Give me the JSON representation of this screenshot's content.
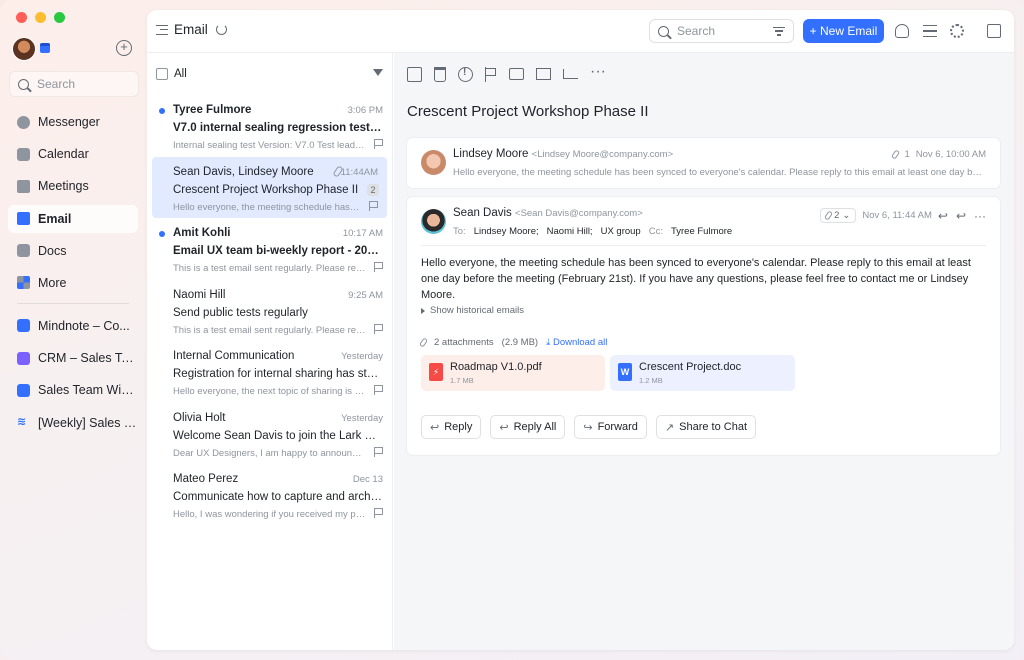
{
  "nav": {
    "search_placeholder": "Search",
    "items": [
      {
        "label": "Messenger",
        "icon": "messenger-icon"
      },
      {
        "label": "Calendar",
        "icon": "calendar-icon"
      },
      {
        "label": "Meetings",
        "icon": "meetings-icon"
      },
      {
        "label": "Email",
        "icon": "email-icon"
      },
      {
        "label": "Docs",
        "icon": "docs-icon"
      },
      {
        "label": "More",
        "icon": "more-icon"
      }
    ],
    "pinned": [
      {
        "label": "Mindnote – Co...",
        "icon": "mindnote-icon"
      },
      {
        "label": "CRM – Sales Te...",
        "icon": "crm-icon"
      },
      {
        "label": "Sales Team Wiki...",
        "icon": "wiki-icon"
      },
      {
        "label": "[Weekly] Sales T...",
        "icon": "weekly-icon"
      }
    ]
  },
  "topbar": {
    "title": "Email",
    "search_placeholder": "Search",
    "new_email": "+ New Email"
  },
  "list": {
    "select_all": "All",
    "mails": [
      {
        "from": "Tyree Fulmore",
        "time": "3:06 PM",
        "subject": "V7.0 internal sealing regression test rep...",
        "preview": "Internal sealing test Version: V7.0 Test leader...",
        "unread": true
      },
      {
        "from": "Sean Davis, Lindsey Moore",
        "time": "11:44AM",
        "subject": "Crescent Project Workshop Phase II",
        "preview": "Hello everyone, the meeting schedule has be...",
        "count": "2",
        "unread": false
      },
      {
        "from": "Amit Kohli",
        "time": "10:17 AM",
        "subject": "Email UX team bi-weekly report - 2023/...",
        "preview": "This is a test email sent regularly. Please repl...",
        "unread": true
      },
      {
        "from": "Naomi Hill",
        "time": "9:25 AM",
        "subject": "Send public tests regularly",
        "preview": "This is a test email sent regularly. Please repl...",
        "unread": false
      },
      {
        "from": "Internal Communication",
        "time": "Yesterday",
        "subject": "Registration for internal sharing has starte...",
        "preview": "Hello everyone, the next topic of sharing is m...",
        "unread": false
      },
      {
        "from": "Olivia Holt",
        "time": "Yesterday",
        "subject": "Welcome Sean Davis to join the Lark UX te...",
        "preview": "Dear UX Designers, I am happy to announce...",
        "unread": false
      },
      {
        "from": "Mateo Perez",
        "time": "Dec 13",
        "subject": "Communicate how to capture and archive...",
        "preview": "Hello, I was wondering if you received my pr...",
        "unread": false
      }
    ]
  },
  "reader": {
    "subject": "Crescent Project Workshop Phase II",
    "msg1": {
      "name": "Lindsey Moore",
      "address": "<Lindsey Moore@company.com>",
      "attach_count": "1",
      "time": "Nov 6, 10:00 AM",
      "preview": "Hello everyone, the meeting schedule has been synced to everyone's calendar. Please reply to this email at least one day before t..."
    },
    "msg2": {
      "name": "Sean Davis",
      "address": "<Sean Davis@company.com>",
      "attach_count": "2",
      "time": "Nov 6, 11:44 AM",
      "to_label": "To:",
      "to": [
        "Lindsey Moore;",
        "Naomi Hill;",
        "UX group"
      ],
      "cc_label": "Cc:",
      "cc": "Tyree Fulmore",
      "body": "Hello everyone, the meeting schedule has been synced to everyone's calendar. Please reply to this email at least one day before the meeting (February 21st). If you have any questions, please feel free to contact me or Lindsey Moore.",
      "history": "Show historical emails",
      "attachments_label": "2 attachments",
      "attachments_size": "(2.9 MB)",
      "download_all": "Download all",
      "files": [
        {
          "name": "Roadmap V1.0.pdf",
          "size": "1.7 MB"
        },
        {
          "name": "Crescent Project.doc",
          "size": "1.2 MB"
        }
      ],
      "buttons": {
        "reply": "Reply",
        "reply_all": "Reply All",
        "forward": "Forward",
        "share": "Share to Chat"
      }
    }
  },
  "colors": {
    "accent": "#3370ff",
    "selected_row": "#e1eaff",
    "pdf": "#f54a45"
  }
}
